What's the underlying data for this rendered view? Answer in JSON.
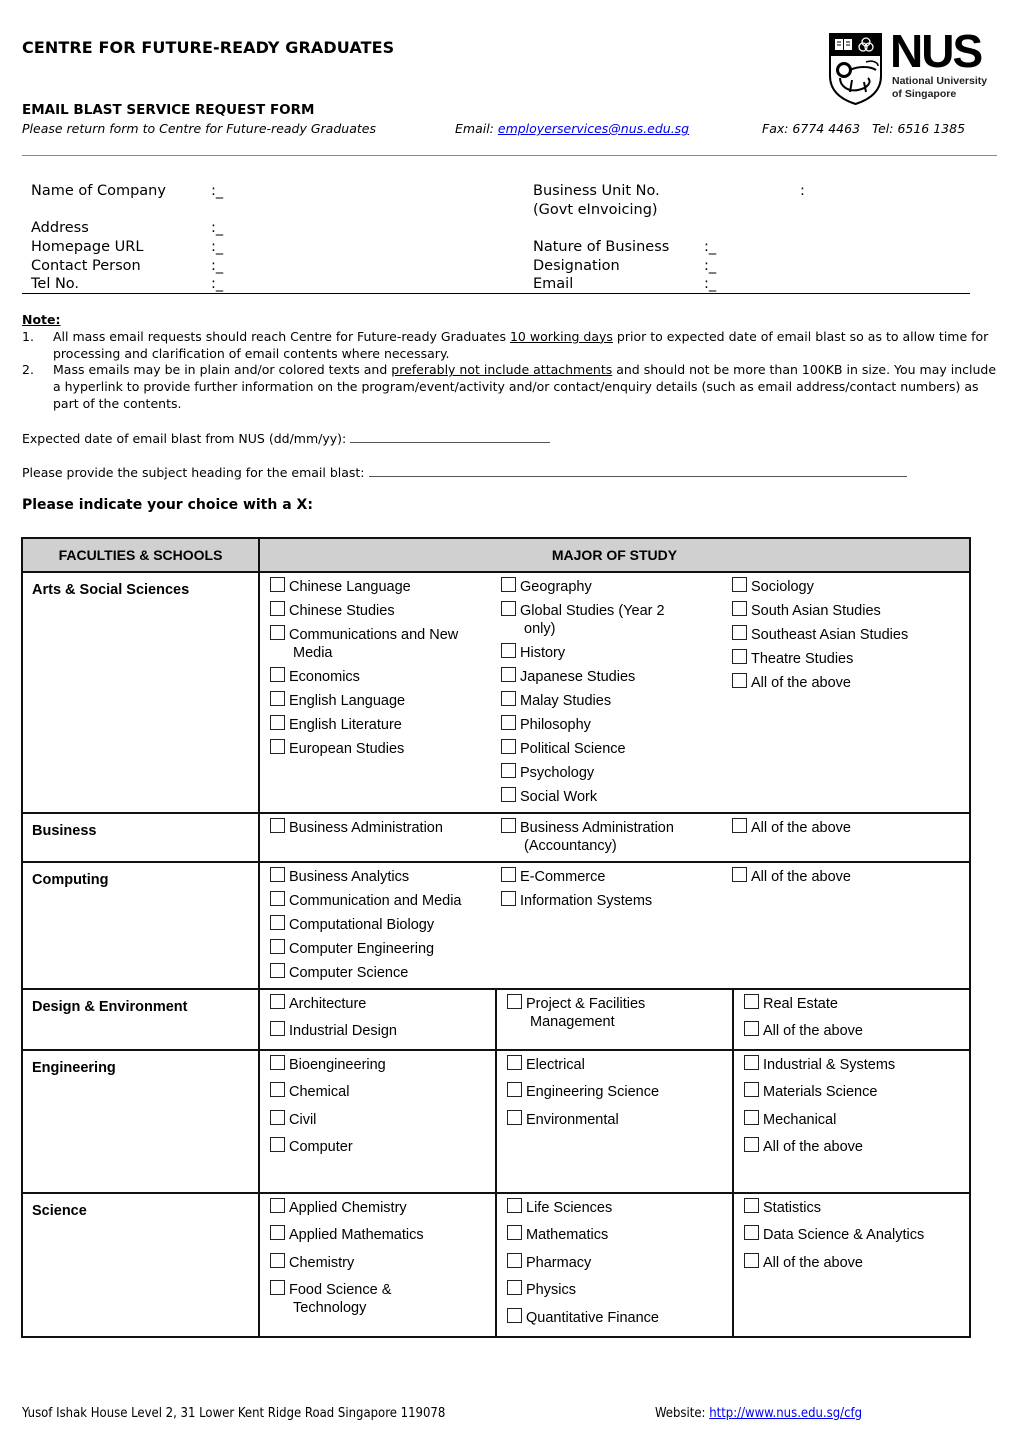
{
  "header": {
    "title": "CENTRE FOR FUTURE-READY GRADUATES",
    "form_title": "EMAIL BLAST SERVICE REQUEST FORM",
    "return_note": "Please return form to Centre for Future-ready Graduates",
    "email_label": "Email: ",
    "email": "employerservices@nus.edu.sg",
    "fax": "Fax: 6774 4463",
    "tel": "Tel: 6516 1385",
    "logo": {
      "wordmark": "NUS",
      "line1": "National University",
      "line2": "of Singapore",
      "icon": "nus-crest-icon"
    }
  },
  "company_info": {
    "left": [
      {
        "label": "Name of Company",
        "value": ":_"
      },
      {
        "label": "Address",
        "value": ":_"
      },
      {
        "label": "Homepage URL",
        "value": ":_"
      },
      {
        "label": "Contact Person",
        "value": ":_"
      },
      {
        "label": "Tel No.",
        "value": ":_"
      }
    ],
    "right": [
      {
        "label": "Business Unit No.",
        "label2": "(Govt eInvoicing)",
        "value": ":"
      },
      {
        "label": "Nature of Business",
        "value": ":_"
      },
      {
        "label": "Designation",
        "value": ":_"
      },
      {
        "label": "Email",
        "value": ":_"
      }
    ]
  },
  "notes": {
    "heading": "Note:",
    "items": [
      {
        "num": "1.",
        "before": "All mass email requests should reach Centre for Future-ready Graduates ",
        "underlined": "10 working days",
        "after": " prior to expected date of email blast so as to allow time for processing and clarification of email contents where necessary."
      },
      {
        "num": "2.",
        "before": "Mass emails may be in plain and/or colored texts and ",
        "underlined": "preferably not include attachments",
        "after": " and should not be more than 100KB in size. You may include a hyperlink to provide further information on the program/event/activity and/or contact/enquiry details (such as email address/contact numbers) as part of the contents."
      }
    ]
  },
  "questions": {
    "date_label": "Expected date of email blast from NUS (dd/mm/yy): ",
    "date_value": "",
    "subject_label": "Please provide the subject heading for the email blast: ",
    "subject_value": "",
    "indicate": "Please indicate your choice with a X:"
  },
  "table": {
    "headers": [
      "FACULTIES & SCHOOLS",
      "MAJOR OF STUDY"
    ],
    "rows": [
      {
        "faculty": "Arts & Social Sciences",
        "cols": [
          [
            "Chinese Language",
            "Chinese Studies",
            "Communications and New|Media",
            "Economics",
            "English Language",
            "English Literature",
            "European Studies"
          ],
          [
            "Geography",
            "Global Studies (Year 2|only)",
            "History",
            "Japanese Studies",
            "Malay Studies",
            "Philosophy",
            "Political Science",
            "Psychology",
            "Social Work"
          ],
          [
            "Sociology",
            "South Asian Studies",
            "Southeast Asian Studies",
            "Theatre Studies",
            "All of the above"
          ]
        ]
      },
      {
        "faculty": "Business",
        "cols": [
          [
            "Business Administration"
          ],
          [
            "Business Administration|(Accountancy)"
          ],
          [
            "All of the above"
          ]
        ]
      },
      {
        "faculty": "Computing",
        "cols": [
          [
            "Business Analytics",
            "Communication and Media",
            "Computational Biology",
            "Computer Engineering",
            "Computer Science"
          ],
          [
            "E-Commerce",
            "Information Systems"
          ],
          [
            "All of the above"
          ]
        ]
      },
      {
        "faculty": "Design & Environment",
        "cols": [
          [
            "Architecture",
            "Industrial Design"
          ],
          [
            "Project & Facilities|Management"
          ],
          [
            "Real Estate",
            "All of the above"
          ]
        ]
      },
      {
        "faculty": "Engineering",
        "cols": [
          [
            "Bioengineering",
            "Chemical",
            "Civil",
            "Computer"
          ],
          [
            "Electrical",
            "Engineering Science",
            "Environmental"
          ],
          [
            "Industrial & Systems",
            "Materials Science",
            "Mechanical",
            "All of the above"
          ]
        ]
      },
      {
        "faculty": "Science",
        "cols": [
          [
            "Applied Chemistry",
            "Applied Mathematics",
            "Chemistry",
            "Food Science &|Technology"
          ],
          [
            "Life Sciences",
            "Mathematics",
            "Pharmacy",
            "Physics",
            "Quantitative Finance"
          ],
          [
            "Statistics",
            "Data Science & Analytics",
            "All of the above"
          ]
        ]
      }
    ]
  },
  "footer": {
    "address": "Yusof Ishak House Level 2, 31 Lower Kent Ridge Road Singapore 119078",
    "website_label": "Website: ",
    "website": "http://www.nus.edu.sg/cfg"
  }
}
